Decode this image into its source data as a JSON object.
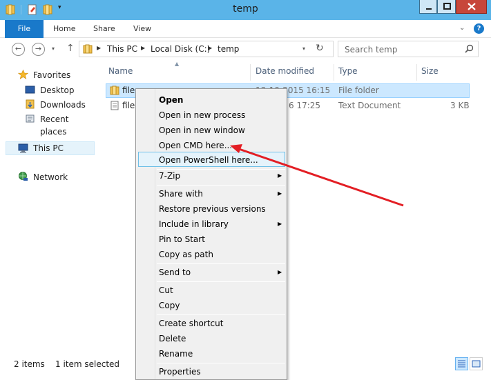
{
  "window": {
    "title": "temp"
  },
  "ribbon": {
    "tabs": [
      "File",
      "Home",
      "Share",
      "View"
    ],
    "help": "?"
  },
  "address": {
    "crumbs": [
      "This PC",
      "Local Disk (C:)",
      "temp"
    ],
    "search_placeholder": "Search temp"
  },
  "navpane": {
    "favorites_label": "Favorites",
    "favorites": [
      "Desktop",
      "Downloads",
      "Recent places"
    ],
    "this_pc": "This PC",
    "network": "Network"
  },
  "columns": [
    "Name",
    "Date modified",
    "Type",
    "Size"
  ],
  "files": [
    {
      "name": "file",
      "date": "13-10-2015 16:15",
      "type": "File folder",
      "size": ""
    },
    {
      "name": "file",
      "date": "6 17:25",
      "type": "Text Document",
      "size": "3 KB"
    }
  ],
  "status": {
    "items": "2 items",
    "selected": "1 item selected"
  },
  "context_menu": {
    "items": [
      "Open",
      "Open in new process",
      "Open in new window",
      "Open CMD here...",
      "Open PowerShell here...",
      "7-Zip",
      "Share with",
      "Restore previous versions",
      "Include in library",
      "Pin to Start",
      "Copy as path",
      "Send to",
      "Cut",
      "Copy",
      "Create shortcut",
      "Delete",
      "Rename",
      "Properties"
    ]
  },
  "colors": {
    "titlebar": "#5ab4e8",
    "file_tab": "#1979ca",
    "selection": "#cce8ff",
    "annotation_arrow": "#e31e24"
  }
}
